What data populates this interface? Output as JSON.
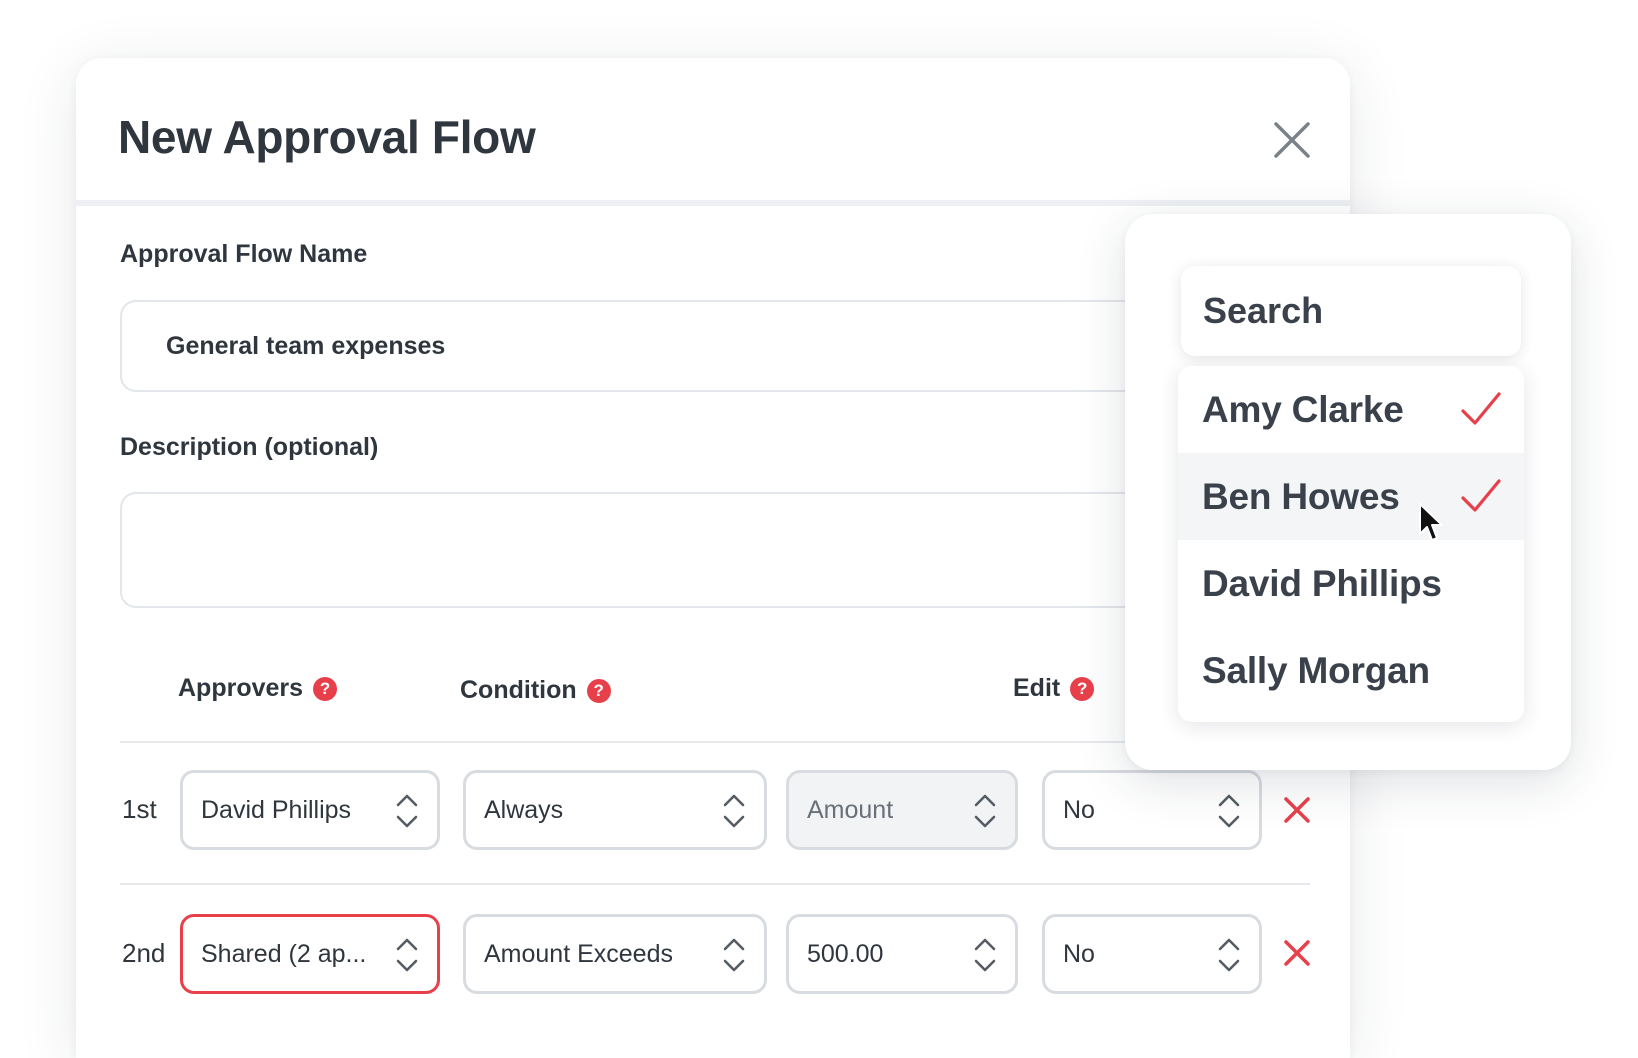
{
  "modal": {
    "title": "New Approval Flow",
    "name_label": "Approval Flow Name",
    "name_value": "General team expenses",
    "description_label": "Description (optional)",
    "description_value": ""
  },
  "table": {
    "columns": {
      "approvers": "Approvers",
      "condition": "Condition",
      "edit": "Edit"
    },
    "help_glyph": "?",
    "rows": [
      {
        "label": "1st",
        "approver": "David Phillips",
        "condition": "Always",
        "amount": "Amount",
        "edit": "No"
      },
      {
        "label": "2nd",
        "approver": "Shared (2 ap...",
        "condition": "Amount Exceeds",
        "amount": "500.00",
        "edit": "No"
      }
    ]
  },
  "dropdown": {
    "search_placeholder": "Search",
    "options": [
      {
        "name": "Amy Clarke",
        "checked": true
      },
      {
        "name": "Ben Howes",
        "checked": true
      },
      {
        "name": "David Phillips",
        "checked": false
      },
      {
        "name": "Sally Morgan",
        "checked": false
      }
    ]
  },
  "colors": {
    "accent_red": "#e8404a",
    "text_dark": "#2f363e",
    "border": "#d8dbe0"
  },
  "icons": [
    "close-icon",
    "help-icon",
    "chevron-updown-icon",
    "remove-x-icon",
    "check-icon",
    "mouse-cursor-icon"
  ]
}
